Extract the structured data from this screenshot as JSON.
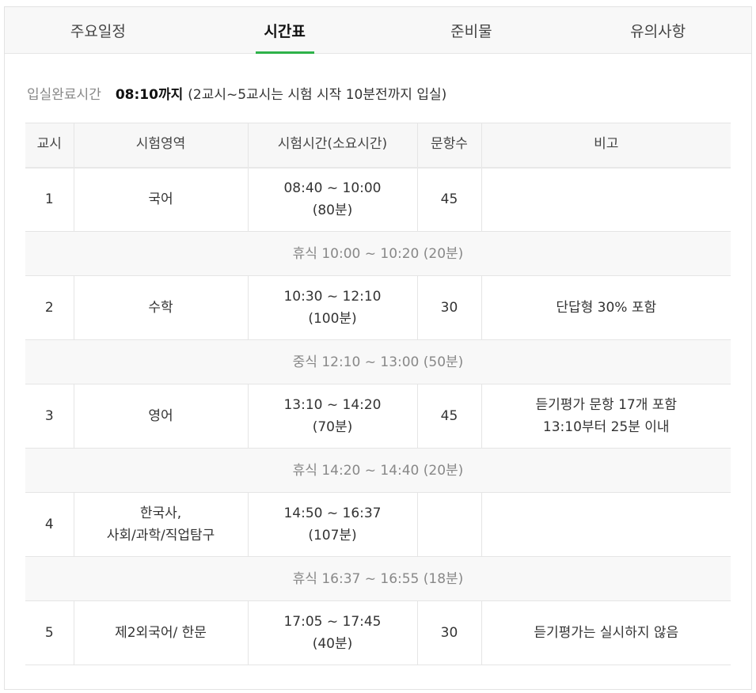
{
  "tabs": [
    {
      "label": "주요일정",
      "active": false
    },
    {
      "label": "시간표",
      "active": true
    },
    {
      "label": "준비물",
      "active": false
    },
    {
      "label": "유의사항",
      "active": false
    }
  ],
  "entry": {
    "label": "입실완료시간",
    "time": "08:10까지",
    "note": "(2교시~5교시는 시험 시작 10분전까지 입실)"
  },
  "table": {
    "headers": [
      "교시",
      "시험영역",
      "시험시간(소요시간)",
      "문항수",
      "비고"
    ],
    "period1": {
      "no": "1",
      "subject": [
        "국어"
      ],
      "time": "08:40 ~ 10:00",
      "duration": "(80분)",
      "count": "45",
      "note": []
    },
    "break1": "휴식 10:00 ~ 10:20 (20분)",
    "period2": {
      "no": "2",
      "subject": [
        "수학"
      ],
      "time": "10:30 ~ 12:10",
      "duration": "(100분)",
      "count": "30",
      "note": [
        "단답형 30% 포함"
      ]
    },
    "break2": "중식 12:10 ~ 13:00 (50분)",
    "period3": {
      "no": "3",
      "subject": [
        "영어"
      ],
      "time": "13:10 ~ 14:20",
      "duration": "(70분)",
      "count": "45",
      "note": [
        "듣기평가 문항 17개 포함",
        "13:10부터 25분 이내"
      ]
    },
    "break3": "휴식 14:20 ~ 14:40 (20분)",
    "period4": {
      "no": "4",
      "subject": [
        "한국사,",
        "사회/과학/직업탐구"
      ],
      "time": "14:50 ~ 16:37",
      "duration": "(107분)",
      "count": "",
      "note": []
    },
    "break4": "휴식 16:37 ~ 16:55 (18분)",
    "period5": {
      "no": "5",
      "subject": [
        "제2외국어/ 한문"
      ],
      "time": "17:05 ~ 17:45",
      "duration": "(40분)",
      "count": "30",
      "note": [
        "듣기평가는 실시하지 않음"
      ]
    }
  }
}
